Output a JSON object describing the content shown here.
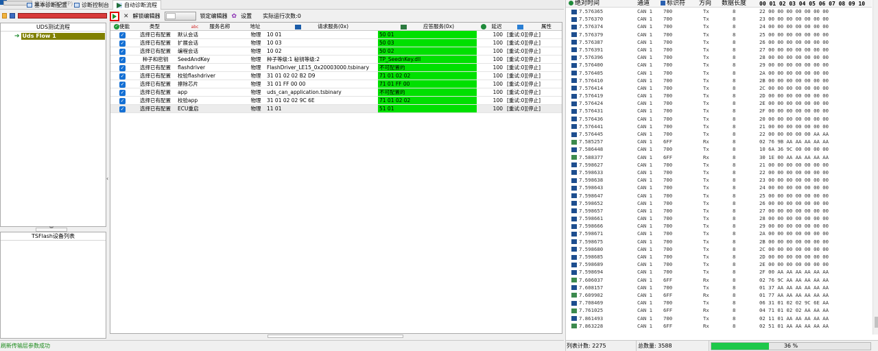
{
  "tabs": [
    {
      "label": "传输层(ISO TP)",
      "state": "disabled"
    },
    {
      "label": "基本诊断配置",
      "state": "normal"
    },
    {
      "label": "诊断控制台",
      "state": "normal"
    },
    {
      "label": "自动诊断流程",
      "state": "active"
    }
  ],
  "tree": {
    "header": "UDS测试流程",
    "node": "Uds Flow 1"
  },
  "device_panel": {
    "header": "TSFlash设备列表"
  },
  "toolbar": {
    "unlock_label": "解锁编辑器",
    "lock_label": "锁定编辑器",
    "settings_label": "设置",
    "run_count_label": "实际运行次数:0"
  },
  "grid": {
    "headers": {
      "enable": "使能",
      "type": "类型",
      "name": "服务名称",
      "address": "地址",
      "request": "请求服务(0x)",
      "response": "应答服务(0x)",
      "delay": "延迟",
      "property": "属性"
    },
    "rows": [
      {
        "type": "选择已有配置",
        "name": "默认会话",
        "address": "物理",
        "request": "10 01",
        "response": "50 01",
        "delay": "100",
        "property": "[重试:0][停止]"
      },
      {
        "type": "选择已有配置",
        "name": "扩展会话",
        "address": "物理",
        "request": "10 03",
        "response": "50 03",
        "delay": "100",
        "property": "[重试:0][停止]"
      },
      {
        "type": "选择已有配置",
        "name": "编程会话",
        "address": "物理",
        "request": "10 02",
        "response": "50 02",
        "delay": "100",
        "property": "[重试:0][停止]"
      },
      {
        "type": "种子和密钥",
        "name": "SeedAndKey",
        "address": "物理",
        "request": "种子等级:1 秘钥等级:2",
        "response": "TP_SeednKey.dll",
        "delay": "100",
        "property": "[重试:0][停止]"
      },
      {
        "type": "选择已有配置",
        "name": "flashdriver",
        "address": "物理",
        "request": "FlashDriver_LE15_0x20003000.tsbinary",
        "response": "不可配置的",
        "delay": "100",
        "property": "[重试:0][停止]"
      },
      {
        "type": "选择已有配置",
        "name": "校验flashdriver",
        "address": "物理",
        "request": "31 01 02 02 B2 D9",
        "response": "71 01 02 02",
        "delay": "100",
        "property": "[重试:0][停止]"
      },
      {
        "type": "选择已有配置",
        "name": "擦除芯片",
        "address": "物理",
        "request": "31 01 FF 00 00",
        "response": "71 01 FF 00",
        "delay": "100",
        "property": "[重试:0][停止]"
      },
      {
        "type": "选择已有配置",
        "name": "app",
        "address": "物理",
        "request": "uds_can_application.tsbinary",
        "response": "不可配置的",
        "delay": "100",
        "property": "[重试:0][停止]"
      },
      {
        "type": "选择已有配置",
        "name": "校验app",
        "address": "物理",
        "request": "31 01 02 02 9C 6E",
        "response": "71 01 02 02",
        "delay": "100",
        "property": "[重试:0][停止]"
      },
      {
        "type": "选择已有配置",
        "name": "ECU重启",
        "address": "物理",
        "request": "11 01",
        "response": "51 01",
        "delay": "100",
        "property": "[重试:0][停止]"
      }
    ]
  },
  "status_message": "刷新传输层参数成功",
  "trace": {
    "headers": {
      "time": "绝对时间",
      "channel": "通道",
      "id": "标识符",
      "dir": "方向",
      "len": "数据长度",
      "data": "00 01 02 03 04 05 06 07 08 09 10"
    },
    "rows": [
      {
        "time": "7.576365",
        "ch": "CAN 1",
        "id": "700",
        "dir": "Tx",
        "len": "8",
        "data": "22 00 00 00 00 00 00 00"
      },
      {
        "time": "7.576370",
        "ch": "CAN 1",
        "id": "700",
        "dir": "Tx",
        "len": "8",
        "data": "23 00 00 00 00 00 00 00"
      },
      {
        "time": "7.576374",
        "ch": "CAN 1",
        "id": "700",
        "dir": "Tx",
        "len": "8",
        "data": "24 00 00 00 00 00 00 00"
      },
      {
        "time": "7.576379",
        "ch": "CAN 1",
        "id": "700",
        "dir": "Tx",
        "len": "8",
        "data": "25 00 00 00 00 00 00 00"
      },
      {
        "time": "7.576387",
        "ch": "CAN 1",
        "id": "700",
        "dir": "Tx",
        "len": "8",
        "data": "26 00 00 00 00 00 00 00"
      },
      {
        "time": "7.576391",
        "ch": "CAN 1",
        "id": "700",
        "dir": "Tx",
        "len": "8",
        "data": "27 00 00 00 00 00 00 00"
      },
      {
        "time": "7.576396",
        "ch": "CAN 1",
        "id": "700",
        "dir": "Tx",
        "len": "8",
        "data": "28 00 00 00 00 00 00 00"
      },
      {
        "time": "7.576400",
        "ch": "CAN 1",
        "id": "700",
        "dir": "Tx",
        "len": "8",
        "data": "29 00 00 00 00 00 00 00"
      },
      {
        "time": "7.576405",
        "ch": "CAN 1",
        "id": "700",
        "dir": "Tx",
        "len": "8",
        "data": "2A 00 00 00 00 00 00 00"
      },
      {
        "time": "7.576410",
        "ch": "CAN 1",
        "id": "700",
        "dir": "Tx",
        "len": "8",
        "data": "2B 00 00 00 00 00 00 00"
      },
      {
        "time": "7.576414",
        "ch": "CAN 1",
        "id": "700",
        "dir": "Tx",
        "len": "8",
        "data": "2C 00 00 00 00 00 00 00"
      },
      {
        "time": "7.576419",
        "ch": "CAN 1",
        "id": "700",
        "dir": "Tx",
        "len": "8",
        "data": "2D 00 00 00 00 00 00 00"
      },
      {
        "time": "7.576424",
        "ch": "CAN 1",
        "id": "700",
        "dir": "Tx",
        "len": "8",
        "data": "2E 00 00 00 00 00 00 00"
      },
      {
        "time": "7.576431",
        "ch": "CAN 1",
        "id": "700",
        "dir": "Tx",
        "len": "8",
        "data": "2F 00 00 00 00 00 00 00"
      },
      {
        "time": "7.576436",
        "ch": "CAN 1",
        "id": "700",
        "dir": "Tx",
        "len": "8",
        "data": "20 00 00 00 00 00 00 00"
      },
      {
        "time": "7.576441",
        "ch": "CAN 1",
        "id": "700",
        "dir": "Tx",
        "len": "8",
        "data": "21 00 00 00 00 00 00 00"
      },
      {
        "time": "7.576445",
        "ch": "CAN 1",
        "id": "700",
        "dir": "Tx",
        "len": "8",
        "data": "22 00 00 00 00 00 AA AA"
      },
      {
        "time": "7.585257",
        "ch": "CAN 1",
        "id": "6FF",
        "dir": "Rx",
        "len": "8",
        "data": "02 76 9B AA AA AA AA AA"
      },
      {
        "time": "7.586448",
        "ch": "CAN 1",
        "id": "700",
        "dir": "Tx",
        "len": "8",
        "data": "10 6A 36 9C 00 00 00 00"
      },
      {
        "time": "7.588377",
        "ch": "CAN 1",
        "id": "6FF",
        "dir": "Rx",
        "len": "8",
        "data": "30 1E 00 AA AA AA AA AA"
      },
      {
        "time": "7.598627",
        "ch": "CAN 1",
        "id": "700",
        "dir": "Tx",
        "len": "8",
        "data": "21 00 00 00 00 00 00 00"
      },
      {
        "time": "7.598633",
        "ch": "CAN 1",
        "id": "700",
        "dir": "Tx",
        "len": "8",
        "data": "22 00 00 00 00 00 00 00"
      },
      {
        "time": "7.598638",
        "ch": "CAN 1",
        "id": "700",
        "dir": "Tx",
        "len": "8",
        "data": "23 00 00 00 00 00 00 00"
      },
      {
        "time": "7.598643",
        "ch": "CAN 1",
        "id": "700",
        "dir": "Tx",
        "len": "8",
        "data": "24 00 00 00 00 00 00 00"
      },
      {
        "time": "7.598647",
        "ch": "CAN 1",
        "id": "700",
        "dir": "Tx",
        "len": "8",
        "data": "25 00 00 00 00 00 00 00"
      },
      {
        "time": "7.598652",
        "ch": "CAN 1",
        "id": "700",
        "dir": "Tx",
        "len": "8",
        "data": "26 00 00 00 00 00 00 00"
      },
      {
        "time": "7.598657",
        "ch": "CAN 1",
        "id": "700",
        "dir": "Tx",
        "len": "8",
        "data": "27 00 00 00 00 00 00 00"
      },
      {
        "time": "7.598661",
        "ch": "CAN 1",
        "id": "700",
        "dir": "Tx",
        "len": "8",
        "data": "28 00 00 00 00 00 00 00"
      },
      {
        "time": "7.598666",
        "ch": "CAN 1",
        "id": "700",
        "dir": "Tx",
        "len": "8",
        "data": "29 00 00 00 00 00 00 00"
      },
      {
        "time": "7.598671",
        "ch": "CAN 1",
        "id": "700",
        "dir": "Tx",
        "len": "8",
        "data": "2A 00 00 00 00 00 00 00"
      },
      {
        "time": "7.598675",
        "ch": "CAN 1",
        "id": "700",
        "dir": "Tx",
        "len": "8",
        "data": "2B 00 00 00 00 00 00 00"
      },
      {
        "time": "7.598680",
        "ch": "CAN 1",
        "id": "700",
        "dir": "Tx",
        "len": "8",
        "data": "2C 00 00 00 00 00 00 00"
      },
      {
        "time": "7.598685",
        "ch": "CAN 1",
        "id": "700",
        "dir": "Tx",
        "len": "8",
        "data": "2D 00 00 00 00 00 00 00"
      },
      {
        "time": "7.598689",
        "ch": "CAN 1",
        "id": "700",
        "dir": "Tx",
        "len": "8",
        "data": "2E 00 00 00 00 00 00 00"
      },
      {
        "time": "7.598694",
        "ch": "CAN 1",
        "id": "700",
        "dir": "Tx",
        "len": "8",
        "data": "2F 00 AA AA AA AA AA AA"
      },
      {
        "time": "7.606037",
        "ch": "CAN 1",
        "id": "6FF",
        "dir": "Rx",
        "len": "8",
        "data": "02 76 9C AA AA AA AA AA"
      },
      {
        "time": "7.608157",
        "ch": "CAN 1",
        "id": "700",
        "dir": "Tx",
        "len": "8",
        "data": "01 37 AA AA AA AA AA AA"
      },
      {
        "time": "7.609902",
        "ch": "CAN 1",
        "id": "6FF",
        "dir": "Rx",
        "len": "8",
        "data": "01 77 AA AA AA AA AA AA"
      },
      {
        "time": "7.708469",
        "ch": "CAN 1",
        "id": "700",
        "dir": "Tx",
        "len": "8",
        "data": "06 31 01 02 02 9C 6E AA"
      },
      {
        "time": "7.761025",
        "ch": "CAN 1",
        "id": "6FF",
        "dir": "Rx",
        "len": "8",
        "data": "04 71 01 02 02 AA AA AA"
      },
      {
        "time": "7.861493",
        "ch": "CAN 1",
        "id": "700",
        "dir": "Tx",
        "len": "8",
        "data": "02 11 01 AA AA AA AA AA"
      },
      {
        "time": "7.863228",
        "ch": "CAN 1",
        "id": "6FF",
        "dir": "Rx",
        "len": "8",
        "data": "02 51 01 AA AA AA AA AA"
      }
    ]
  },
  "trace_status": {
    "list_count": "列表计数: 2275",
    "total": "总数量: 3588",
    "progress_percent": 36,
    "progress_label": "36 %"
  },
  "colors": {
    "ok_green": "#00e000",
    "node_highlight": "#808000",
    "play_border": "#e00000"
  }
}
